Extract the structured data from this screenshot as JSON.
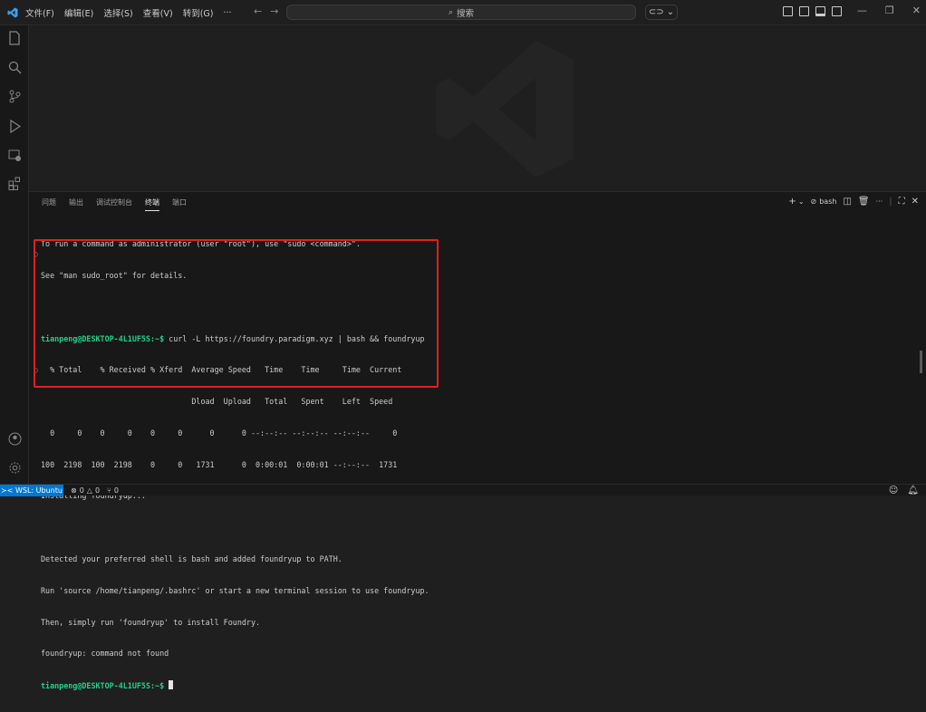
{
  "titlebar": {
    "menu": [
      "文件(F)",
      "编辑(E)",
      "选择(S)",
      "查看(V)",
      "转到(G)",
      "···"
    ],
    "search_placeholder": "搜索"
  },
  "panel": {
    "tabs": [
      "问题",
      "输出",
      "调试控制台",
      "终端",
      "端口"
    ],
    "active_tab": "终端",
    "terminal_name": "bash"
  },
  "terminal": {
    "lines": [
      "To run a command as administrator (user \"root\"), use \"sudo <command>\".",
      "See \"man sudo_root\" for details.",
      "",
      "",
      "  % Total    % Received % Xferd  Average Speed   Time    Time     Time  Current",
      "                                 Dload  Upload   Total   Spent    Left  Speed",
      "  0     0    0     0    0     0      0      0 --:--:-- --:--:-- --:--:--     0",
      "100  2198  100  2198    0     0   1731      0  0:00:01  0:00:01 --:--:--  1731",
      "Installing foundryup...",
      "",
      "Detected your preferred shell is bash and added foundryup to PATH.",
      "Run 'source /home/tianpeng/.bashrc' or start a new terminal session to use foundryup.",
      "Then, simply run 'foundryup' to install Foundry.",
      "foundryup: command not found"
    ],
    "prompt": "tianpeng@DESKTOP-4L1UF5S:~$",
    "command": " curl -L https://foundry.paradigm.xyz | bash && foundryup"
  },
  "statusbar": {
    "remote": "WSL: Ubuntu",
    "errors": "0",
    "warnings": "0",
    "ports": "0"
  },
  "colors": {
    "accent": "#0078d4",
    "prompt": "#23d18b",
    "highlight": "#e02020"
  }
}
